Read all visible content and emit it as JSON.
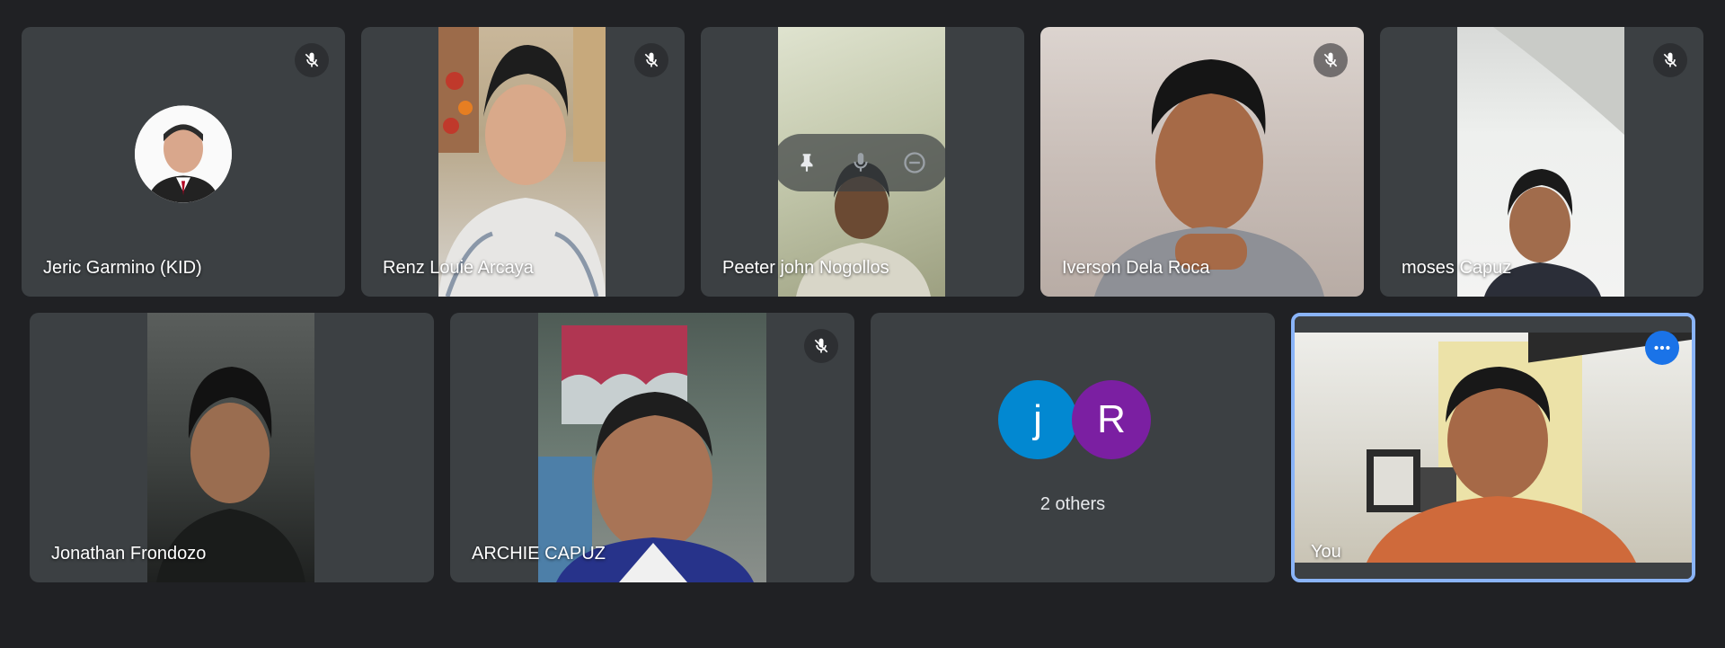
{
  "participants_row1": [
    {
      "name": "Jeric Garmino (KID)",
      "muted": true
    },
    {
      "name": "Renz Louie Arcaya",
      "muted": true
    },
    {
      "name": "Peeter john Nogollos",
      "muted": false
    },
    {
      "name": "Iverson Dela Roca",
      "muted": true
    },
    {
      "name": "moses Capuz",
      "muted": true
    }
  ],
  "participants_row2": [
    {
      "name": "Jonathan Frondozo",
      "muted": false
    },
    {
      "name": "ARCHIE CAPUZ",
      "muted": true
    }
  ],
  "others": {
    "label": "2 others",
    "avatars": [
      {
        "letter": "j",
        "color": "#0288d1"
      },
      {
        "letter": "R",
        "color": "#7b1fa2"
      }
    ]
  },
  "self": {
    "name": "You"
  },
  "icons": {
    "mic_off": "mic-off-icon",
    "pin": "pin-icon",
    "mic": "mic-icon",
    "remove": "remove-icon",
    "more": "more-options-icon"
  },
  "colors": {
    "background": "#202124",
    "tile": "#3c4043",
    "self_border": "#8ab4f8",
    "more_button": "#1a73e8"
  }
}
